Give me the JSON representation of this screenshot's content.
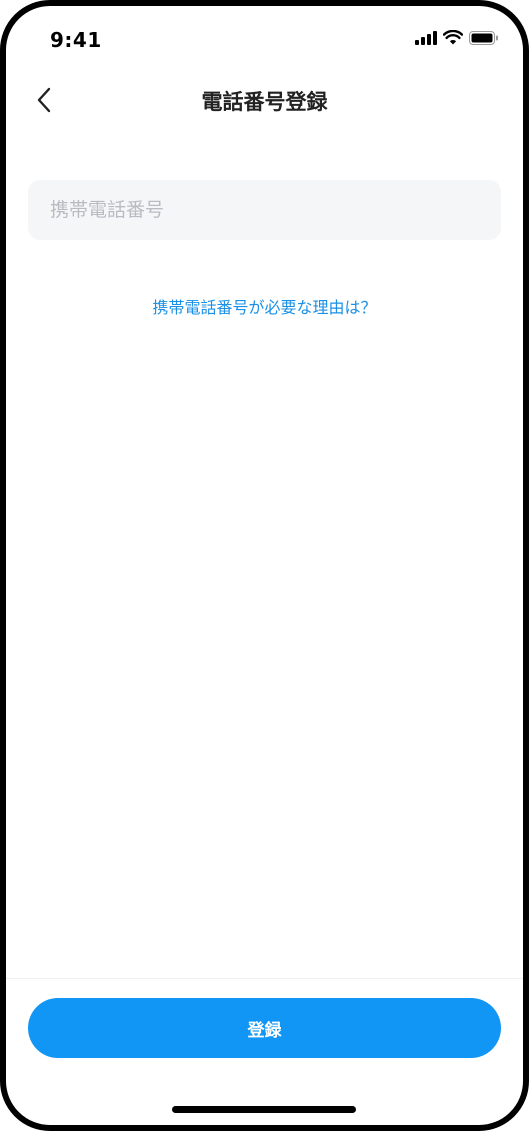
{
  "status_bar": {
    "time": "9:41",
    "icons": [
      "cellular-signal-icon",
      "wifi-icon",
      "battery-icon"
    ]
  },
  "nav": {
    "back_icon": "chevron-left-icon",
    "title": "電話番号登録"
  },
  "phone_input": {
    "placeholder": "携帯電話番号",
    "value": ""
  },
  "why_link": {
    "label": "携帯電話番号が必要な理由は？"
  },
  "register_button": {
    "label": "登録"
  },
  "colors": {
    "accent": "#1296f5",
    "link": "#1a90e6",
    "input_bg": "#f5f6f8",
    "placeholder": "#b8bcc2",
    "title": "#222222"
  }
}
